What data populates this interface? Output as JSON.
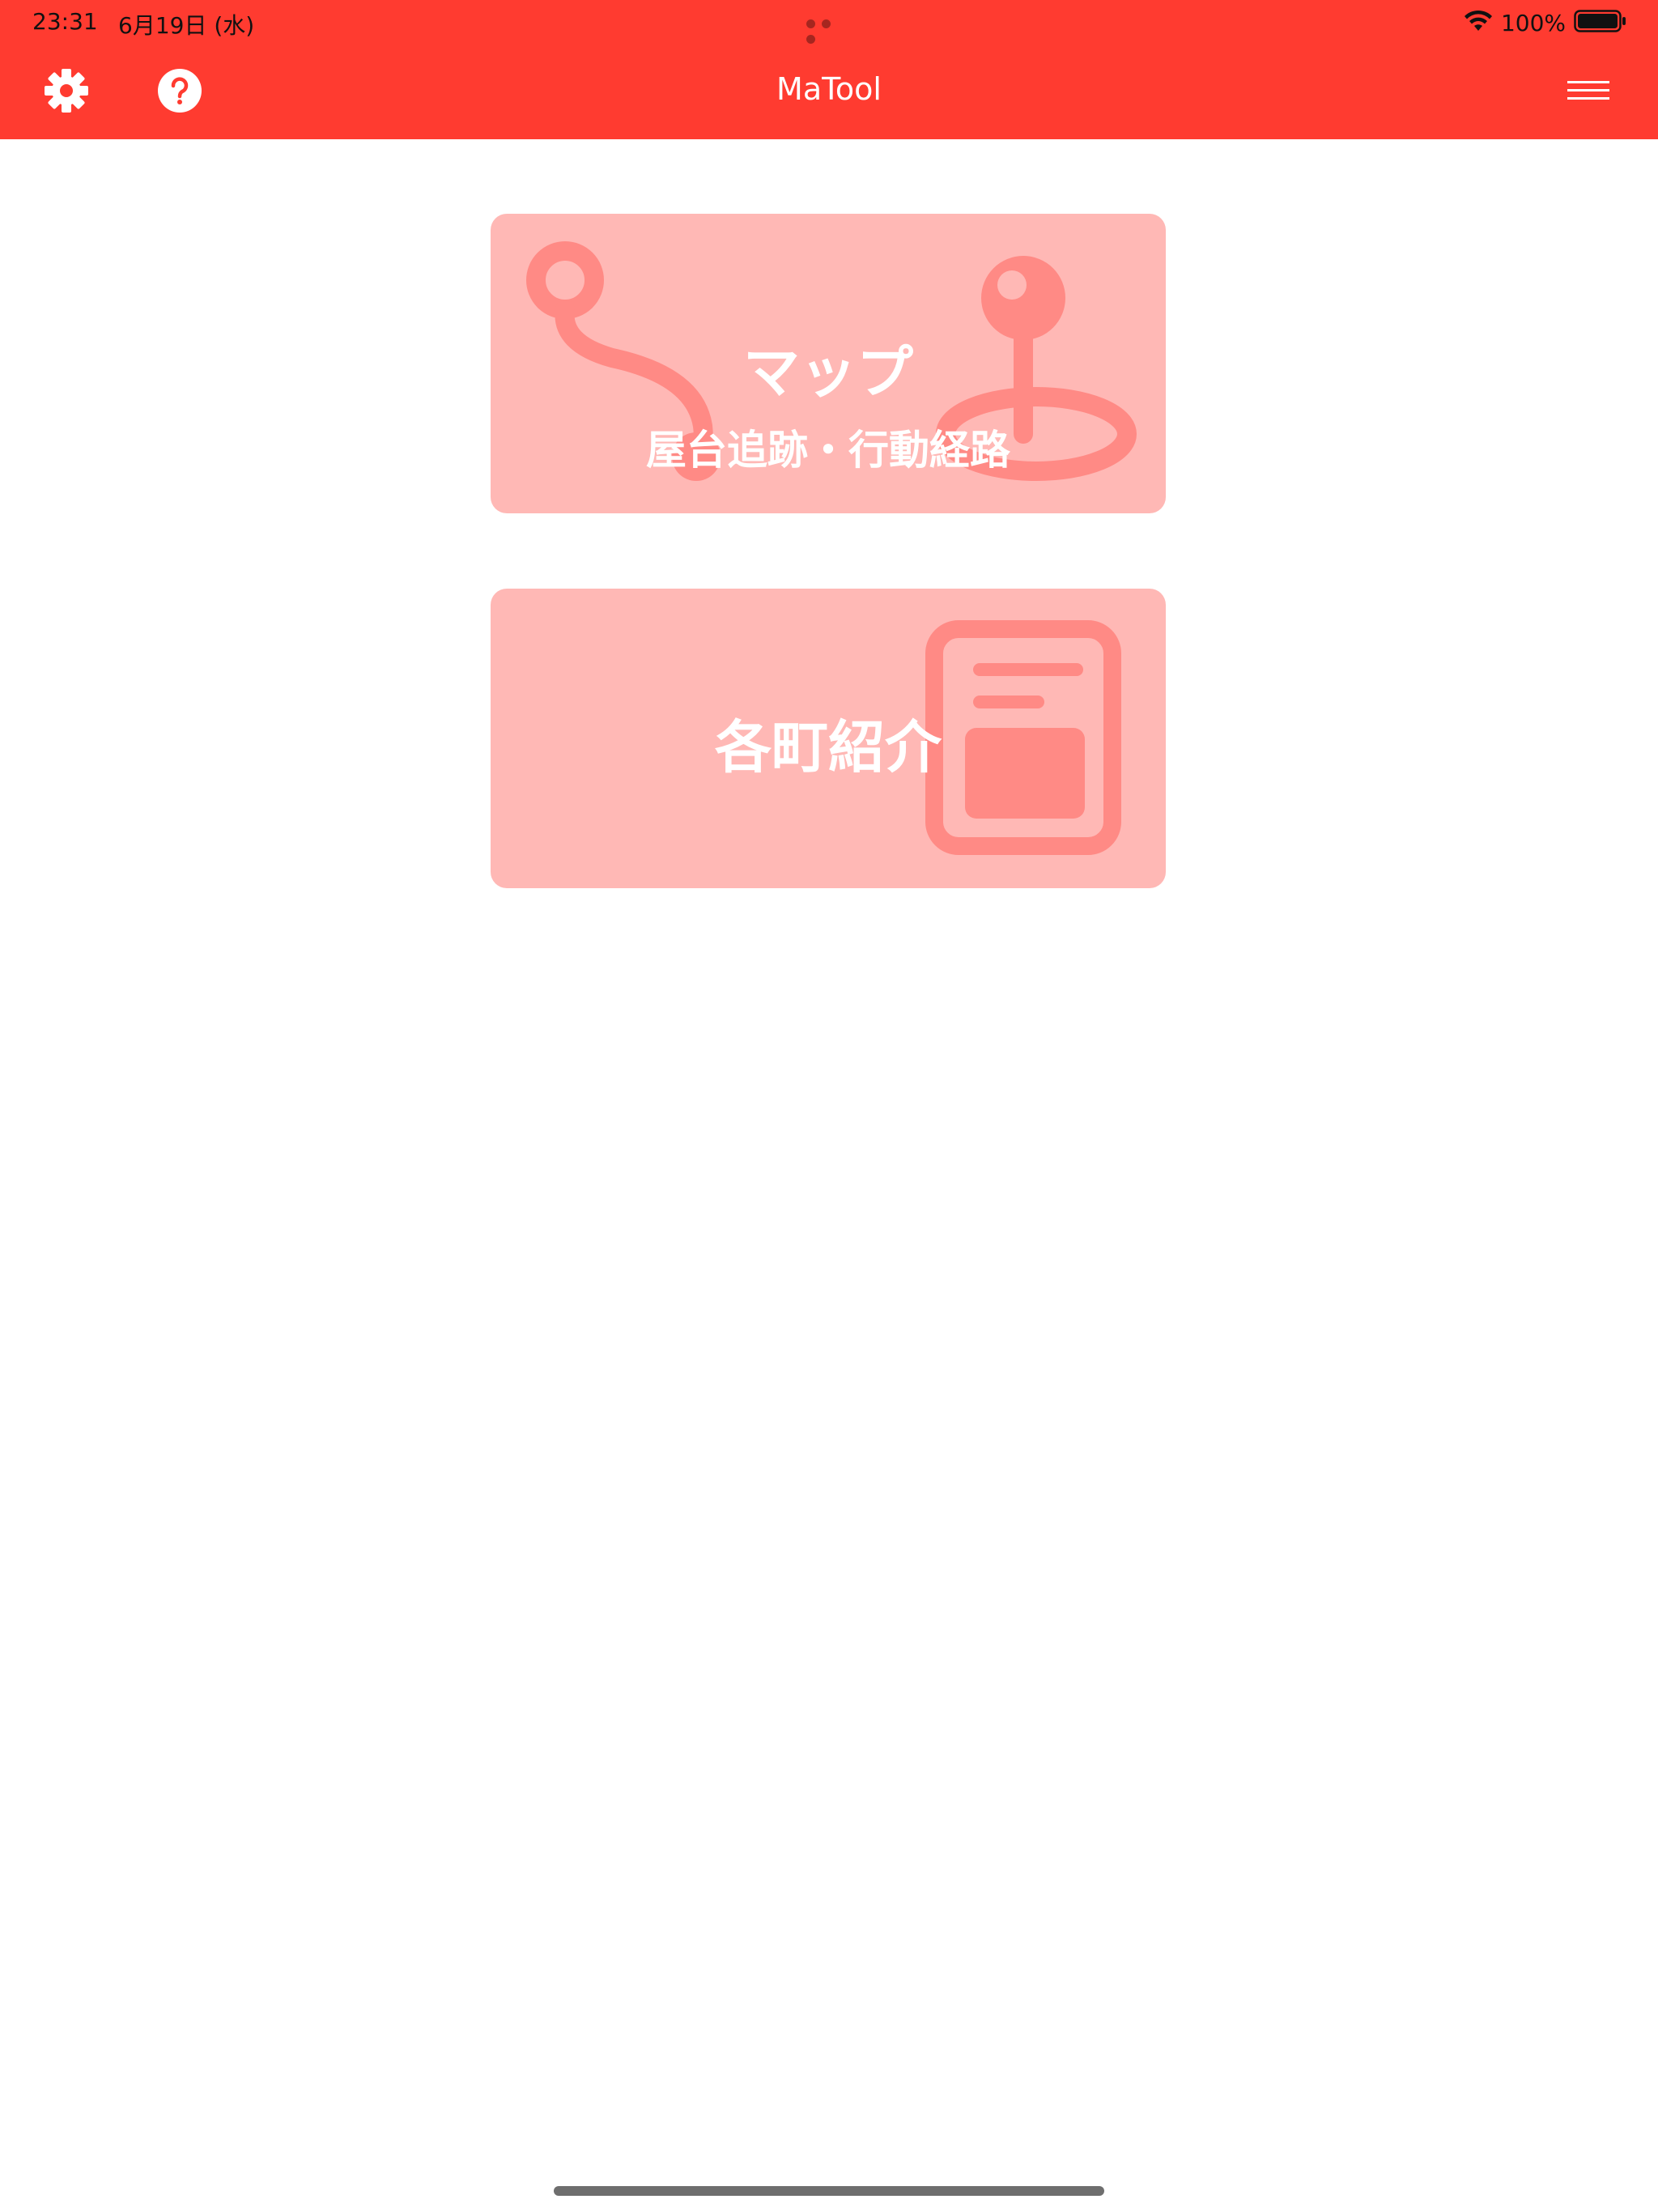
{
  "status_bar": {
    "time": "23:31",
    "date": "6月19日 (水)",
    "battery_percent": "100%",
    "battery_level": 1.0
  },
  "nav": {
    "title": "MaTool",
    "left_icons": [
      "gear-icon",
      "help-icon"
    ],
    "right_icon": "menu-icon"
  },
  "cards": [
    {
      "title": "マップ",
      "subtitle": "屋台追跡・行動経路",
      "icon": "route-map-icon"
    },
    {
      "title": "各町紹介",
      "icon": "document-icon"
    }
  ],
  "colors": {
    "accent": "#FF3B30",
    "card_background": "#FFB8B5",
    "card_illustration": "#FF8A85",
    "text_on_accent": "#FFFFFF"
  }
}
